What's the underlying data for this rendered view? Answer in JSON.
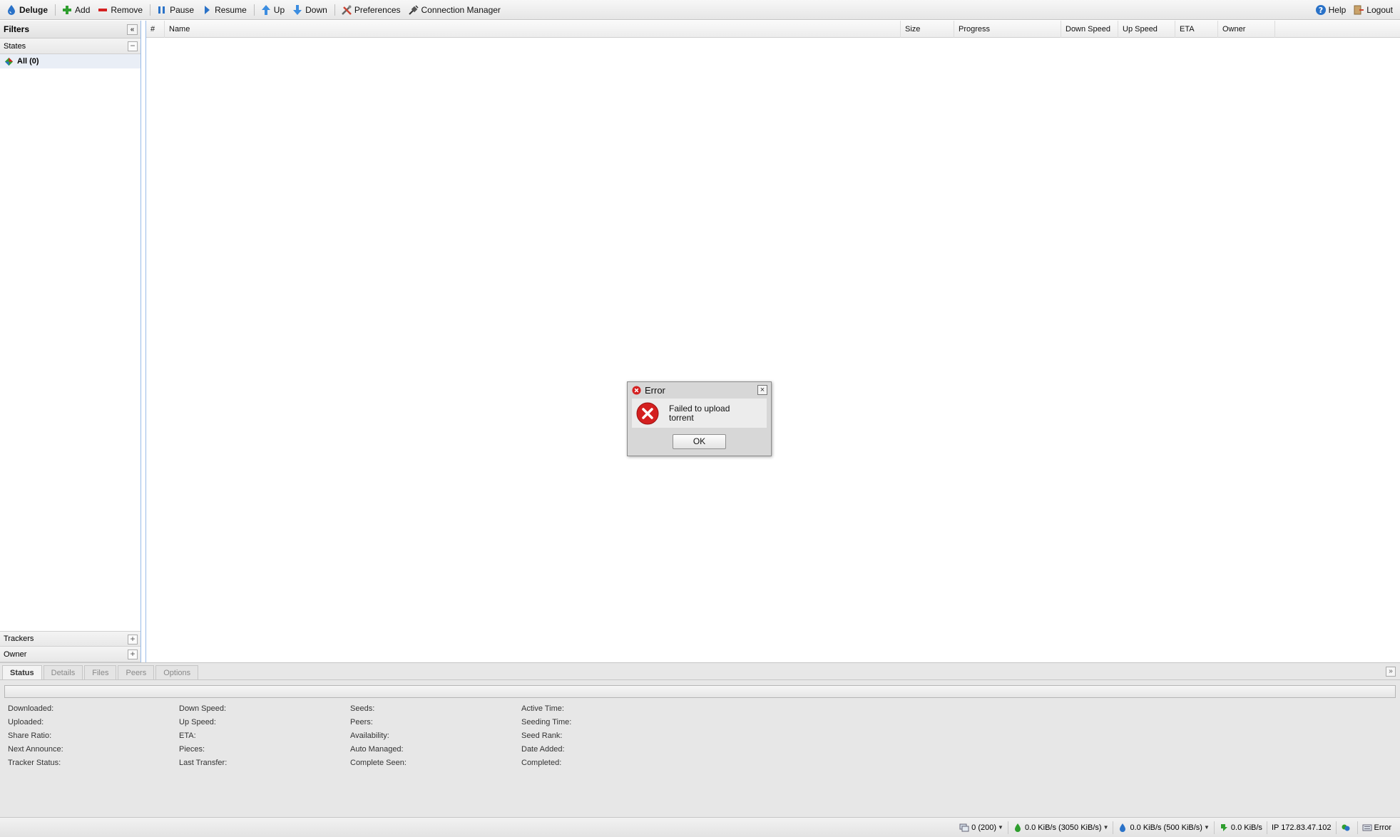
{
  "toolbar": {
    "brand": "Deluge",
    "add": "Add",
    "remove": "Remove",
    "pause": "Pause",
    "resume": "Resume",
    "up": "Up",
    "down": "Down",
    "preferences": "Preferences",
    "connection_manager": "Connection Manager",
    "help": "Help",
    "logout": "Logout"
  },
  "sidebar": {
    "title": "Filters",
    "states_label": "States",
    "all_filter": "All (0)",
    "trackers_label": "Trackers",
    "owner_label": "Owner"
  },
  "grid": {
    "columns": [
      "#",
      "Name",
      "Size",
      "Progress",
      "Down Speed",
      "Up Speed",
      "ETA",
      "Owner"
    ]
  },
  "details": {
    "tabs": [
      "Status",
      "Details",
      "Files",
      "Peers",
      "Options"
    ],
    "stats": [
      [
        "Downloaded:",
        "Uploaded:",
        "Share Ratio:",
        "Next Announce:",
        "Tracker Status:"
      ],
      [
        "Down Speed:",
        "Up Speed:",
        "ETA:",
        "Pieces:",
        "Last Transfer:"
      ],
      [
        "Seeds:",
        "Peers:",
        "Availability:",
        "Auto Managed:",
        "Complete Seen:"
      ],
      [
        "Active Time:",
        "Seeding Time:",
        "Seed Rank:",
        "Date Added:",
        "Completed:"
      ]
    ],
    "progress": 0
  },
  "statusbar": {
    "connections": "0 (200)",
    "download": "0.0 KiB/s (3050 KiB/s)",
    "upload": "0.0 KiB/s (500 KiB/s)",
    "protocol": "0.0 KiB/s",
    "ip": "IP 172.83.47.102",
    "dht_status": "Error"
  },
  "dialog": {
    "title": "Error",
    "message": "Failed to upload torrent",
    "ok_label": "OK"
  },
  "colors": {
    "accent_border": "#99bbe8",
    "error_red": "#d42020",
    "selected_filter_bg": "#e9eef6"
  }
}
